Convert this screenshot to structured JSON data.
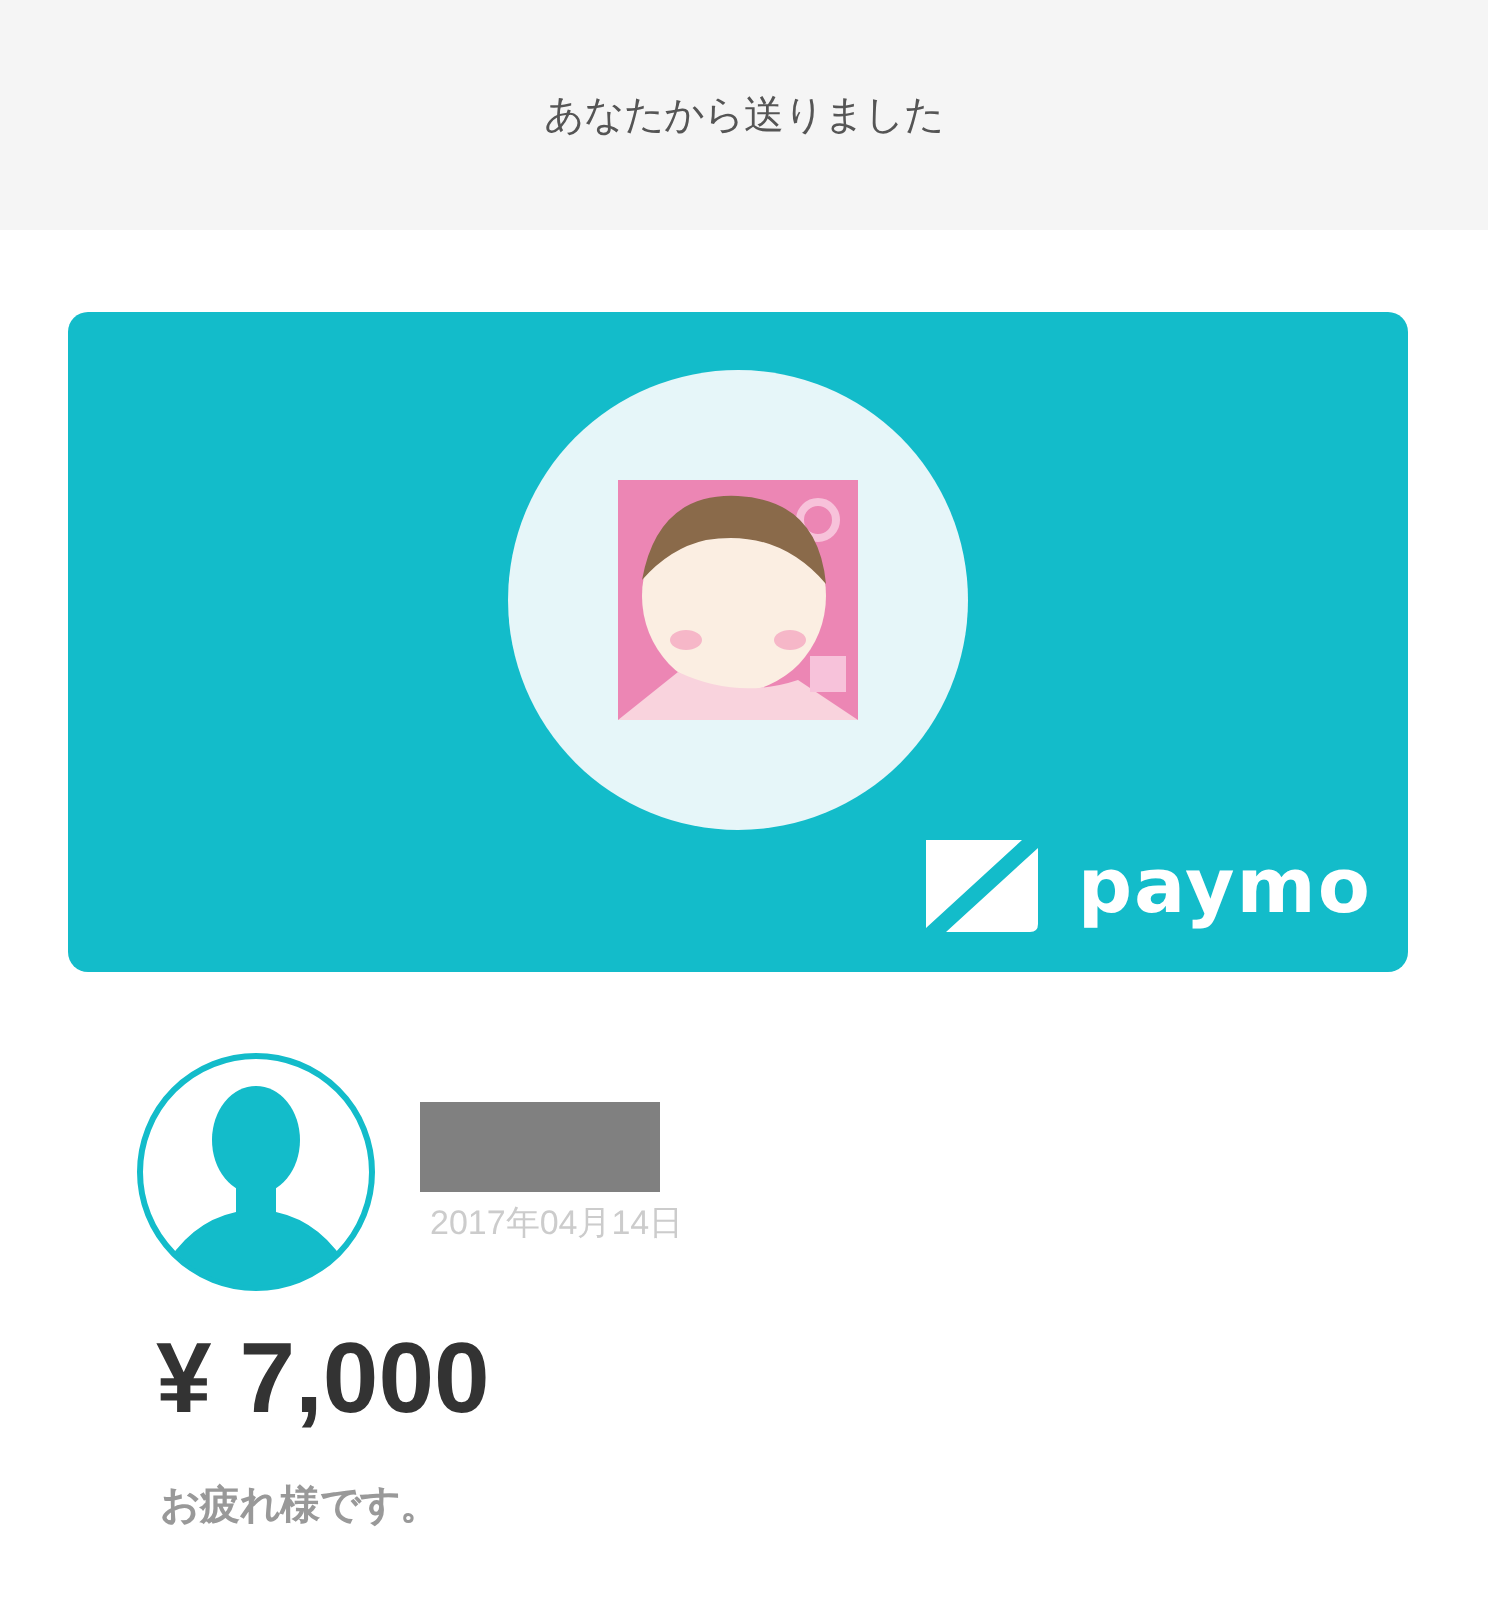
{
  "header": {
    "title": "あなたから送りました"
  },
  "card": {
    "brand": "paymo"
  },
  "sender": {
    "date": "2017年04月14日"
  },
  "payment": {
    "amount": "¥ 7,000",
    "message": "お疲れ様です。"
  }
}
